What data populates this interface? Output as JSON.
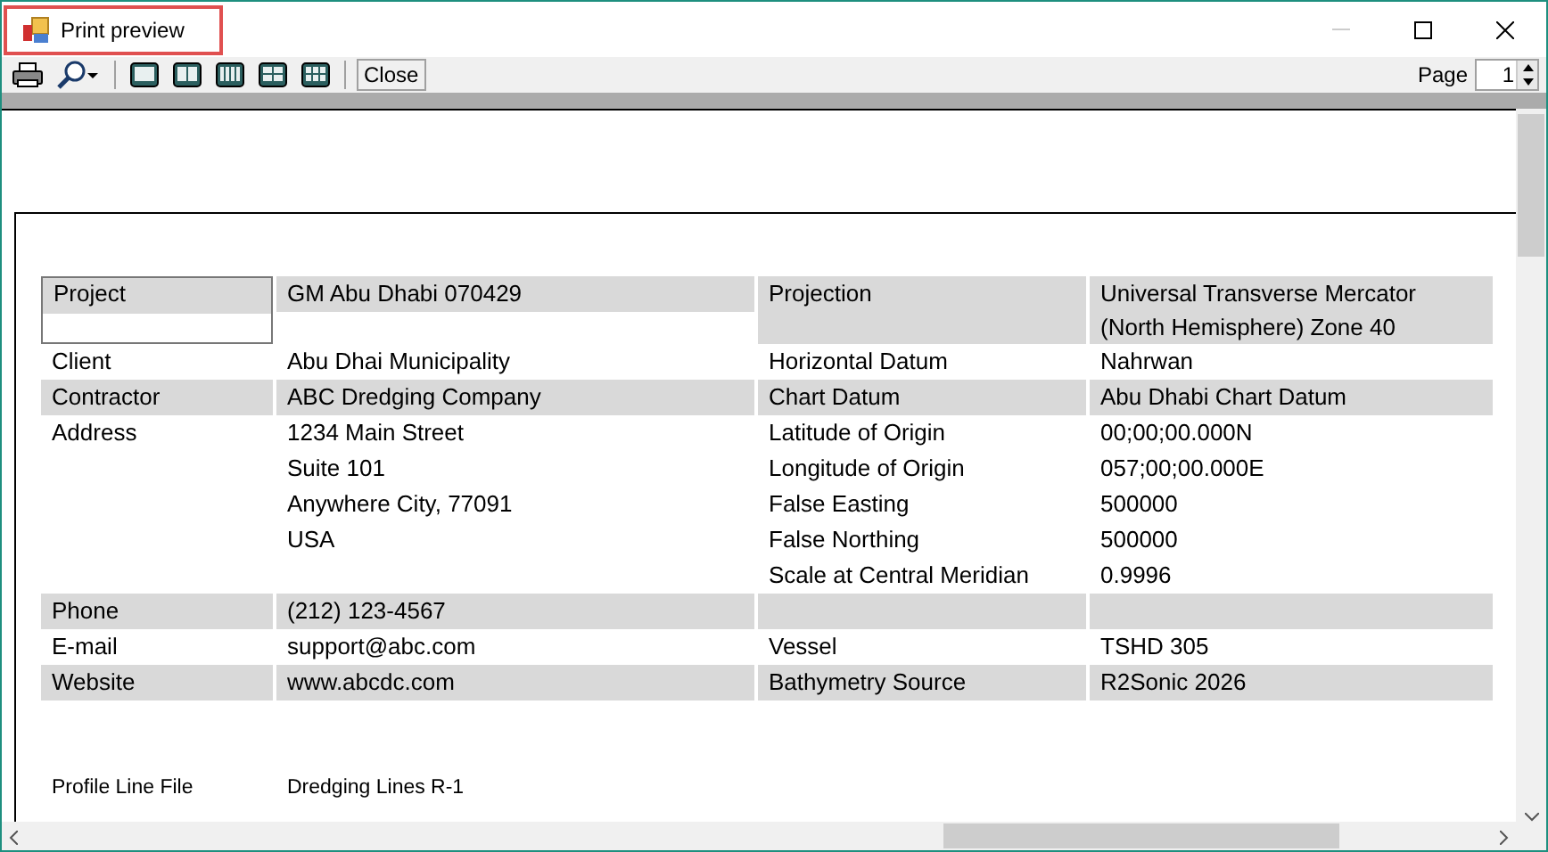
{
  "window": {
    "title": "Print preview",
    "highlighted": true,
    "minimize_disabled": true
  },
  "toolbar": {
    "tools": [
      {
        "kind": "print"
      },
      {
        "kind": "zoom"
      },
      {
        "kind": "separator"
      },
      {
        "kind": "one-page"
      },
      {
        "kind": "two-pages"
      },
      {
        "kind": "three-pages"
      },
      {
        "kind": "four-pages"
      },
      {
        "kind": "six-pages"
      },
      {
        "kind": "separator"
      },
      {
        "kind": "button",
        "label": "Close"
      }
    ],
    "page_label": "Page",
    "page_value": "1"
  },
  "report": {
    "rows": [
      {
        "label": "Project",
        "value": "GM Abu Dhabi 070429",
        "label2": "Projection",
        "value2": "Universal Transverse Mercator (North Hemisphere) Zone 40",
        "shaded": true,
        "boxed": true
      },
      {
        "label": "Client",
        "value": "Abu Dhai Municipality",
        "label2": "Horizontal Datum",
        "value2": "Nahrwan",
        "shaded": false,
        "boxed": false
      },
      {
        "label": "Contractor",
        "value": "ABC Dredging Company",
        "label2": "Chart Datum",
        "value2": "Abu Dhabi Chart Datum",
        "shaded": true,
        "boxed": false
      },
      {
        "label": "Address",
        "value": "1234 Main Street",
        "label2": "Latitude of Origin",
        "value2": "00;00;00.000N",
        "shaded": false,
        "boxed": false
      },
      {
        "value": "Suite 101",
        "label2": "Longitude of Origin",
        "value2": "057;00;00.000E",
        "shaded": false,
        "boxed": false
      },
      {
        "value": "Anywhere City, 77091",
        "label2": "False Easting",
        "value2": "500000",
        "shaded": false,
        "boxed": false
      },
      {
        "value": "USA",
        "label2": "False Northing",
        "value2": "500000",
        "shaded": false,
        "boxed": false
      },
      {
        "label2": "Scale at Central Meridian",
        "value2": "0.9996",
        "shaded": false,
        "boxed": false
      },
      {
        "label": "Phone",
        "value": "(212) 123-4567",
        "shaded": true,
        "boxed": false
      },
      {
        "label": "E-mail",
        "value": "support@abc.com",
        "label2": "Vessel",
        "value2": "TSHD 305",
        "shaded": false,
        "boxed": false
      },
      {
        "label": "Website",
        "value": "www.abcdc.com",
        "label2": "Bathymetry Source",
        "value2": "R2Sonic 2026",
        "shaded": true,
        "boxed": false
      }
    ],
    "footer": {
      "label": "Profile Line File",
      "value": "Dredging Lines R-1"
    }
  }
}
